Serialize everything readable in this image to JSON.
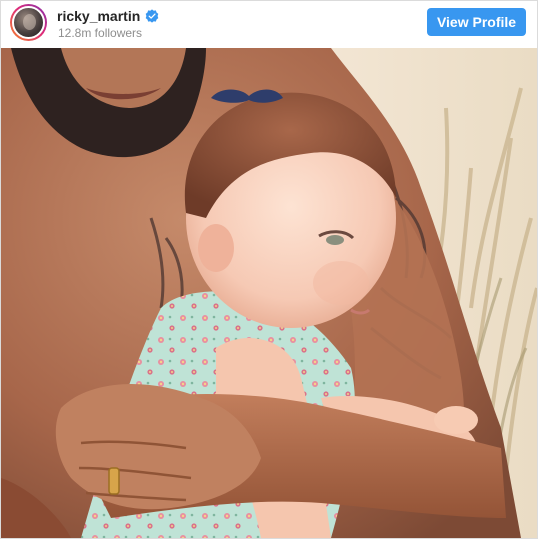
{
  "post": {
    "username": "ricky_martin",
    "followers": "12.8m followers",
    "view_profile_label": "View Profile",
    "verified": true,
    "icons": {
      "avatar": "profile-avatar",
      "verified": "verified-badge-icon"
    },
    "colors": {
      "button": "#3897f0",
      "username": "#262626",
      "secondary_text": "#8e8e8e",
      "verified_badge": "#3897f0"
    }
  }
}
